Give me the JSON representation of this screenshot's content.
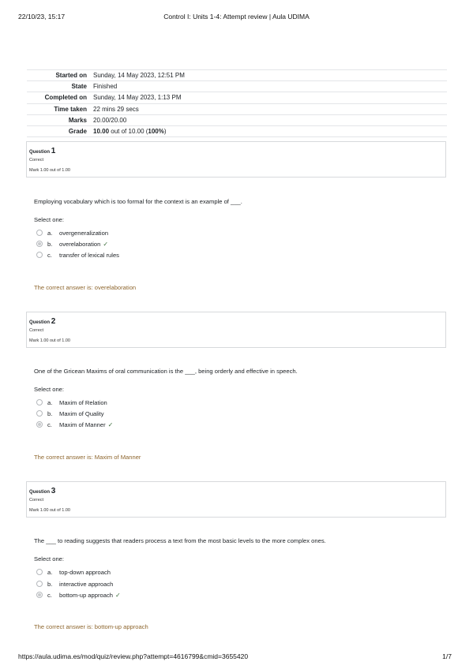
{
  "header": {
    "date": "22/10/23, 15:17",
    "title": "Control I: Units 1-4: Attempt review | Aula UDIMA"
  },
  "footer": {
    "url": "https://aula.udima.es/mod/quiz/review.php?attempt=4616799&cmid=3655420",
    "page": "1/7"
  },
  "summary": [
    {
      "label": "Started on",
      "value": "Sunday, 14 May 2023, 12:51 PM"
    },
    {
      "label": "State",
      "value": "Finished"
    },
    {
      "label": "Completed on",
      "value": "Sunday, 14 May 2023, 1:13 PM"
    },
    {
      "label": "Time taken",
      "value": "22 mins 29 secs"
    },
    {
      "label": "Marks",
      "value": "20.00/20.00"
    },
    {
      "label": "Grade",
      "value_bold": "10.00",
      "value_mid": " out of 10.00 (",
      "value_pct": "100%",
      "value_end": ")"
    }
  ],
  "questions": [
    {
      "label": "Question",
      "number": "1",
      "state": "Correct",
      "mark": "Mark 1.00 out of 1.00",
      "text": "Employing vocabulary which is too formal for the context is an example of ___.",
      "select_label": "Select one:",
      "options": [
        {
          "letter": "a.",
          "text": "overgeneralization",
          "selected": false
        },
        {
          "letter": "b.",
          "text": "overelaboration",
          "selected": true
        },
        {
          "letter": "c.",
          "text": "transfer of lexical rules",
          "selected": false
        }
      ],
      "correct_answer": "The correct answer is: overelaboration"
    },
    {
      "label": "Question",
      "number": "2",
      "state": "Correct",
      "mark": "Mark 1.00 out of 1.00",
      "text": "One of the Gricean Maxims of oral communication is the ___, being orderly and effective in speech.",
      "select_label": "Select one:",
      "options": [
        {
          "letter": "a.",
          "text": "Maxim of Relation",
          "selected": false
        },
        {
          "letter": "b.",
          "text": "Maxim of Quality",
          "selected": false
        },
        {
          "letter": "c.",
          "text": "Maxim of Manner",
          "selected": true
        }
      ],
      "correct_answer": "The correct answer is: Maxim of Manner"
    },
    {
      "label": "Question",
      "number": "3",
      "state": "Correct",
      "mark": "Mark 1.00 out of 1.00",
      "text": "The ___ to reading suggests that readers process a text from the most basic levels to the more complex ones.",
      "select_label": "Select one:",
      "options": [
        {
          "letter": "a.",
          "text": "top-down approach",
          "selected": false
        },
        {
          "letter": "b.",
          "text": "interactive approach",
          "selected": false
        },
        {
          "letter": "c.",
          "text": "bottom-up approach",
          "selected": true
        }
      ],
      "correct_answer": "The correct answer is: bottom-up approach"
    }
  ],
  "icons": {
    "check": "check-icon",
    "check_glyph": "✓",
    "radio": "radio-icon"
  },
  "colors": {
    "answer": "#8e662e",
    "check": "#3c6d3c"
  }
}
